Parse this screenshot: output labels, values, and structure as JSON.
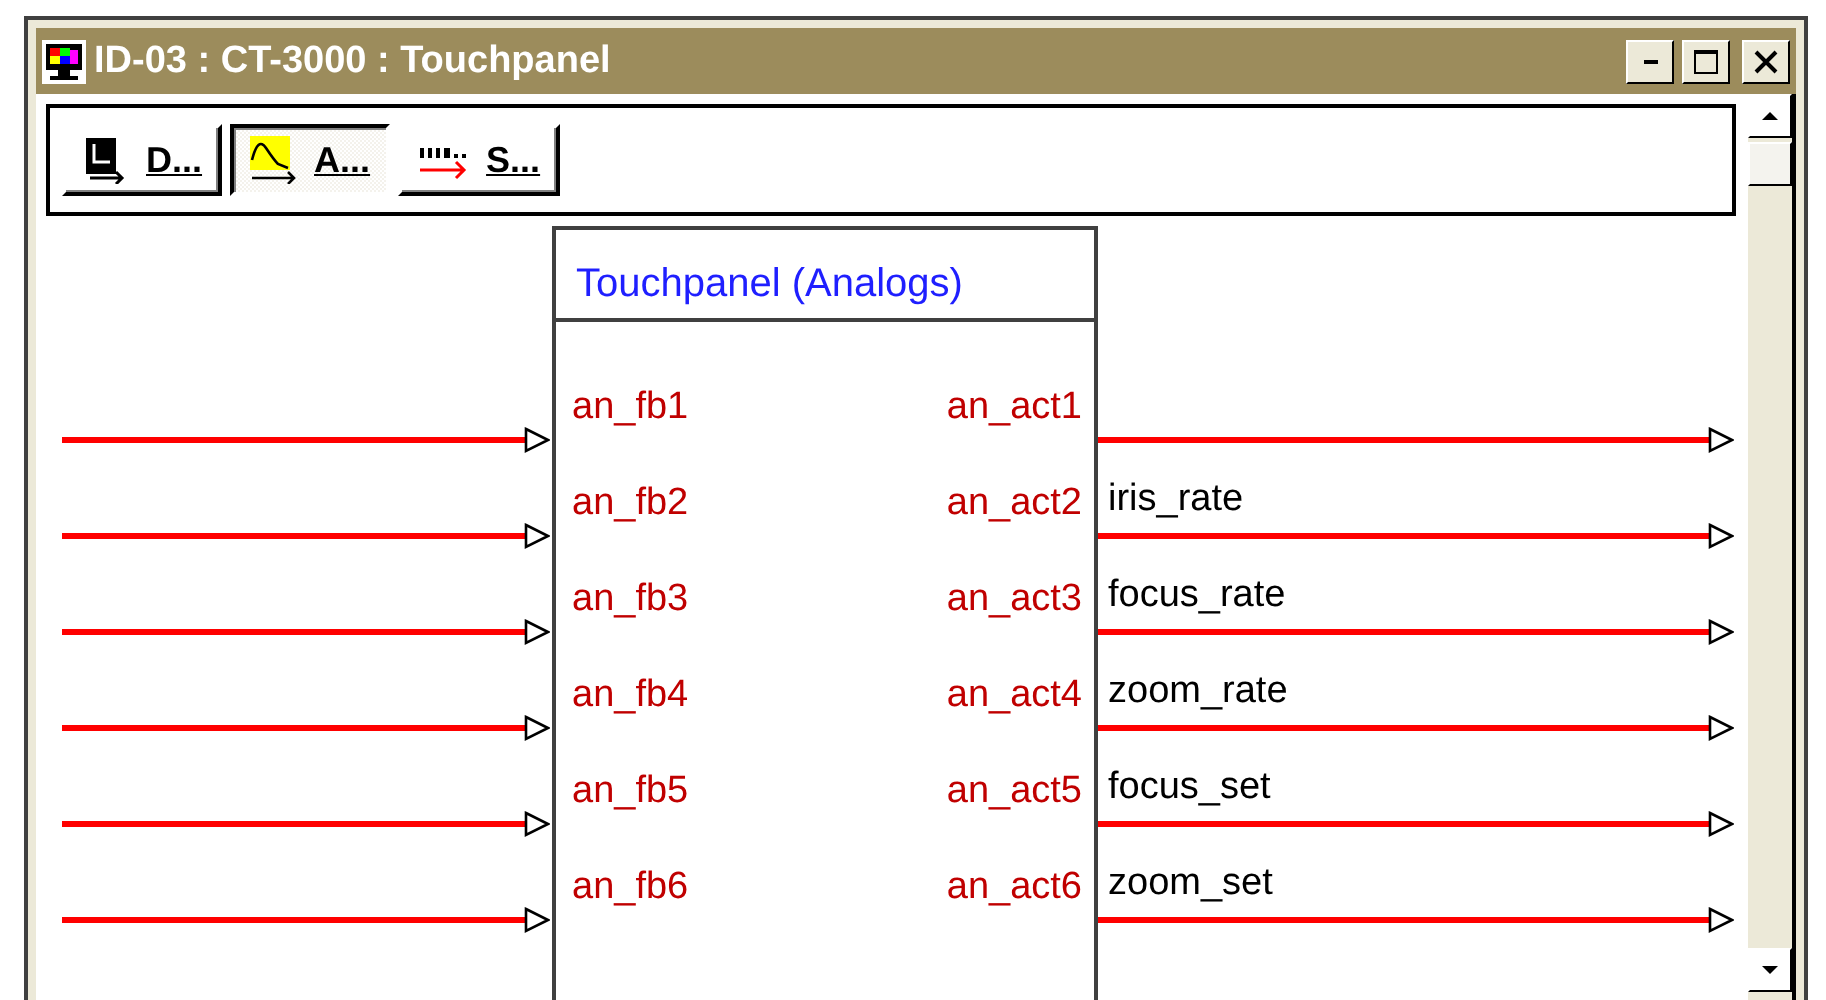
{
  "window": {
    "title": "ID-03 : CT-3000 : Touchpanel"
  },
  "toolbar": {
    "buttons": [
      {
        "label": "D...",
        "kind": "digital",
        "selected": false
      },
      {
        "label": "A...",
        "kind": "analog",
        "selected": true
      },
      {
        "label": "S...",
        "kind": "serial",
        "selected": false
      }
    ]
  },
  "block": {
    "title": "Touchpanel (Analogs)",
    "inputs": [
      "an_fb1",
      "an_fb2",
      "an_fb3",
      "an_fb4",
      "an_fb5",
      "an_fb6"
    ],
    "outputs": [
      {
        "port": "an_act1"
      },
      {
        "port": "an_act2",
        "signal": "iris_rate"
      },
      {
        "port": "an_act3",
        "signal": "focus_rate"
      },
      {
        "port": "an_act4",
        "signal": "zoom_rate"
      },
      {
        "port": "an_act5",
        "signal": "focus_set"
      },
      {
        "port": "an_act6",
        "signal": "zoom_set"
      }
    ]
  }
}
